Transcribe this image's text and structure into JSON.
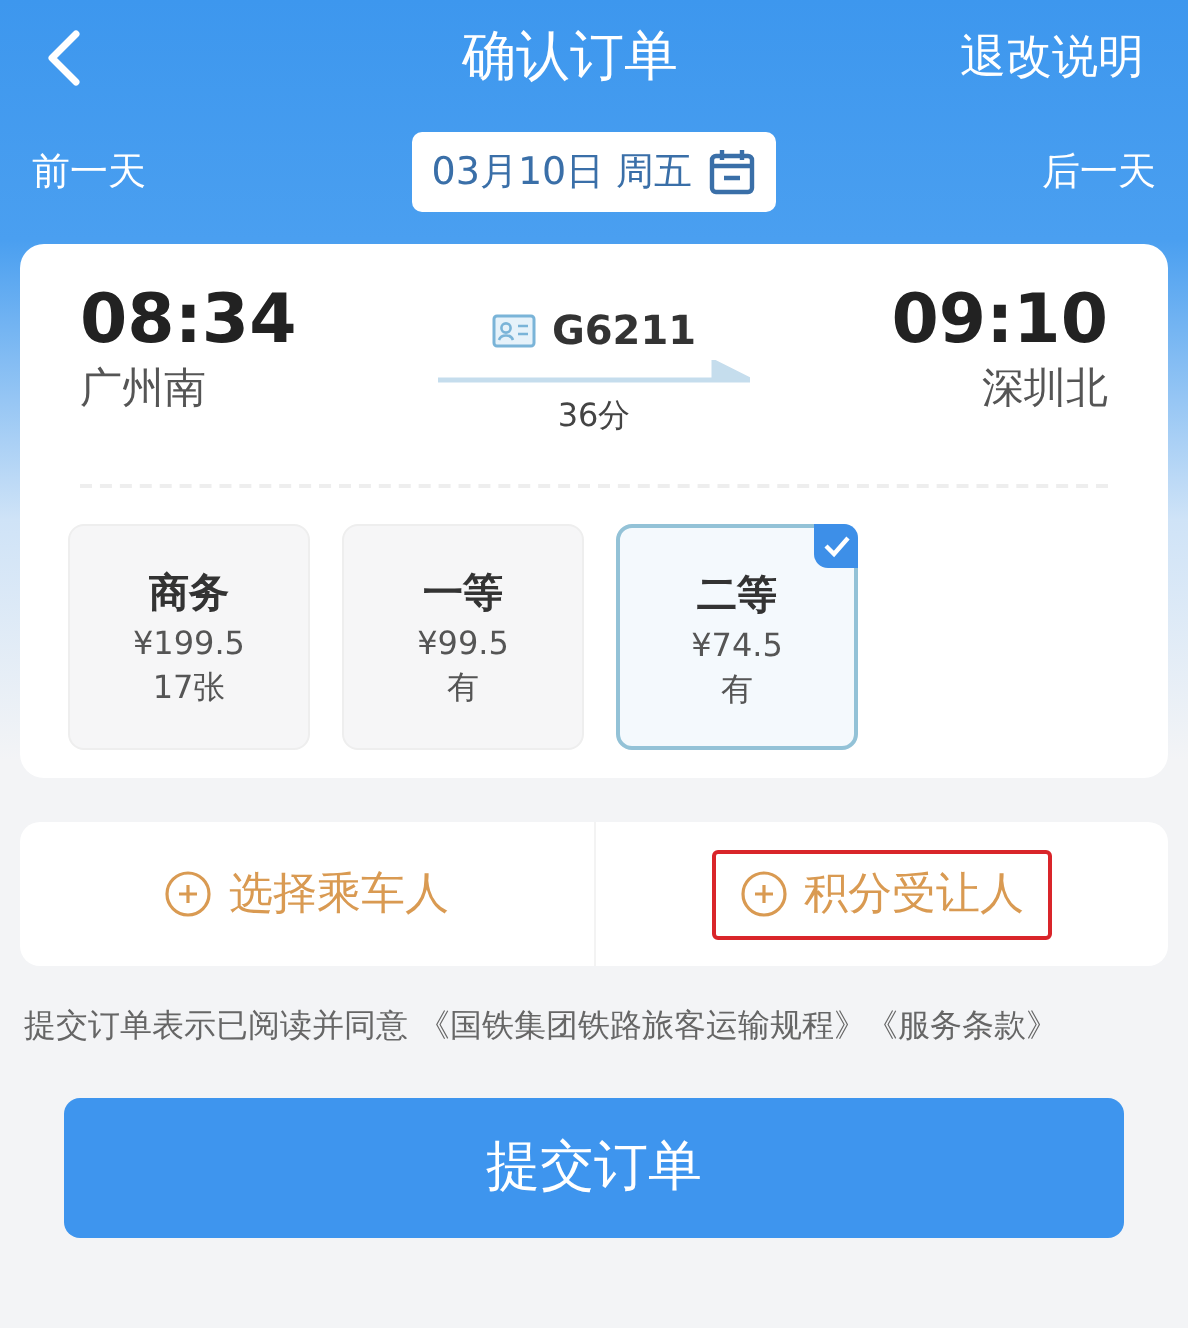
{
  "header": {
    "title": "确认订单",
    "action": "退改说明"
  },
  "date_bar": {
    "prev": "前一天",
    "date": "03月10日 周五",
    "next": "后一天"
  },
  "train": {
    "depart_time": "08:34",
    "depart_station": "广州南",
    "number": "G6211",
    "duration": "36分",
    "arrive_time": "09:10",
    "arrive_station": "深圳北"
  },
  "seats": [
    {
      "name": "商务",
      "price": "¥199.5",
      "availability": "17张",
      "selected": false
    },
    {
      "name": "一等",
      "price": "¥99.5",
      "availability": "有",
      "selected": false
    },
    {
      "name": "二等",
      "price": "¥74.5",
      "availability": "有",
      "selected": true
    }
  ],
  "actions": [
    {
      "label": "选择乘车人",
      "highlighted": false
    },
    {
      "label": "积分受让人",
      "highlighted": true
    }
  ],
  "terms": {
    "text": "提交订单表示已阅读并同意",
    "links": [
      "《国铁集团铁路旅客运输规程》",
      "《服务条款》"
    ]
  },
  "submit": "提交订单"
}
